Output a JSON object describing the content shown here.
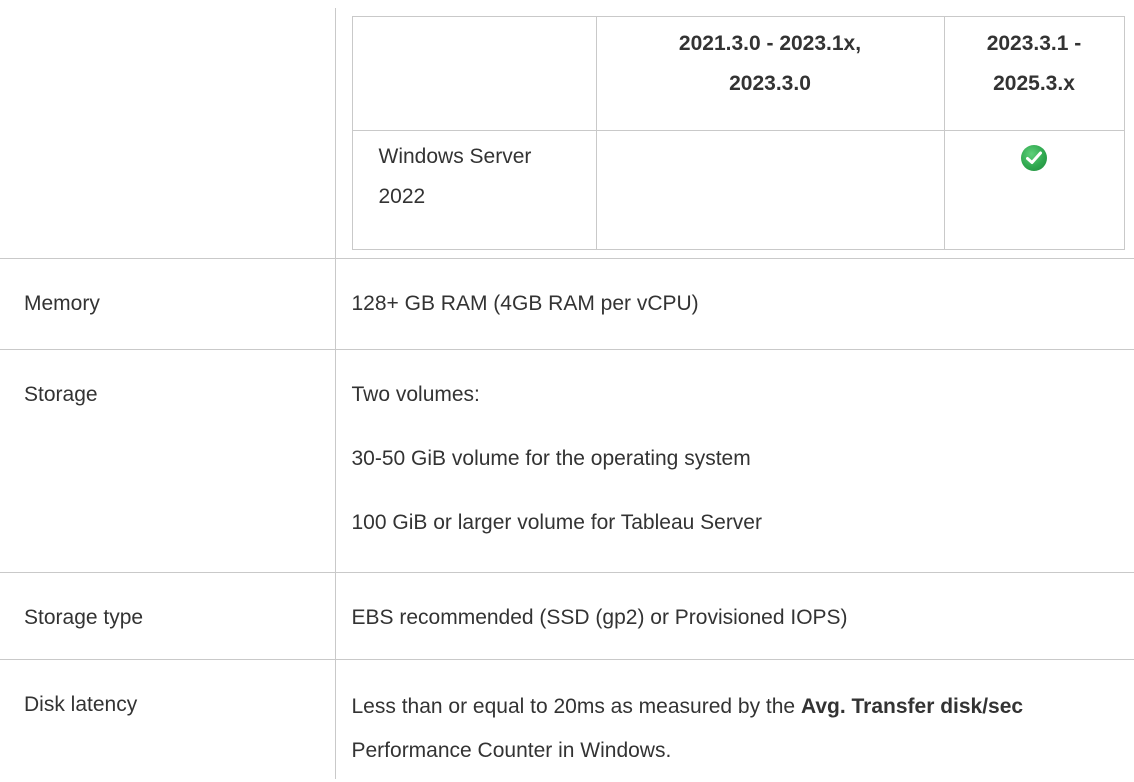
{
  "os_table": {
    "headers": [
      "",
      "2021.3.0 - 2023.1x, 2023.3.0",
      "2023.3.1 - 2025.3.x"
    ],
    "header_lines": [
      [
        "2021.3.0 - 2023.1x,",
        "2023.3.0"
      ],
      [
        "2023.3.1 -",
        "2025.3.x"
      ]
    ],
    "rows": [
      {
        "os_line1": "Windows Server",
        "os_line2": "2022",
        "col_2021": "",
        "col_2023_supported": true,
        "check_icon": "check-circle-icon",
        "check_color": "#2fa84f"
      }
    ]
  },
  "memory": {
    "label": "Memory",
    "value": "128+ GB RAM (4GB RAM per vCPU)"
  },
  "storage": {
    "label": "Storage",
    "lines": [
      "Two volumes:",
      "30-50 GiB volume for the operating system",
      "100 GiB or larger volume for Tableau Server"
    ]
  },
  "storage_type": {
    "label": "Storage type",
    "value": "EBS recommended (SSD (gp2) or Provisioned IOPS)"
  },
  "disk_latency": {
    "label": "Disk latency",
    "text_before": "Less than or equal to 20ms as measured by the ",
    "bold": "Avg. Transfer disk/sec",
    "text_after": " Performance Counter in Windows."
  },
  "colors": {
    "border": "#c9c9c9",
    "text": "#333333",
    "check": "#2fa84f"
  }
}
